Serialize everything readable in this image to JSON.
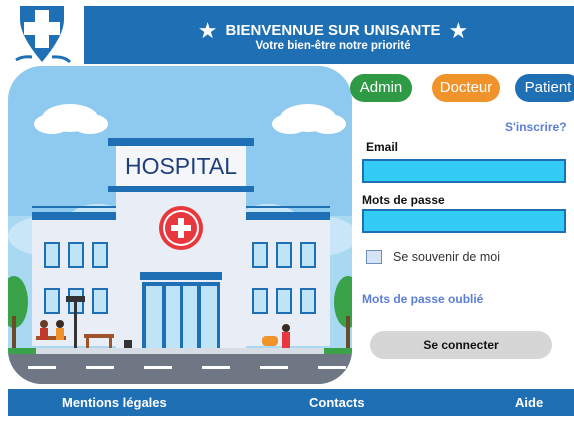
{
  "header": {
    "title": "BIENVENNUE  SUR UNISANTE",
    "subtitle": "Votre bien-être notre priorité"
  },
  "roles": {
    "admin": "Admin",
    "doctor": "Docteur",
    "patient": "Patient"
  },
  "illustration": {
    "sign": "HOSPITAL"
  },
  "login": {
    "signup_link": "S'inscrire?",
    "email_label": "Email",
    "email_value": "",
    "password_label": "Mots de passe",
    "password_value": "",
    "remember_label": "Se souvenir de moi",
    "remember_checked": false,
    "forgot_link": "Mots de passe oublié",
    "submit_label": "Se connecter"
  },
  "footer": {
    "legal": "Mentions légales",
    "contacts": "Contacts",
    "help": "Aide"
  },
  "colors": {
    "primary": "#1f6fb5",
    "admin": "#2e9a45",
    "doctor": "#f0932b",
    "field": "#33ccf5"
  }
}
